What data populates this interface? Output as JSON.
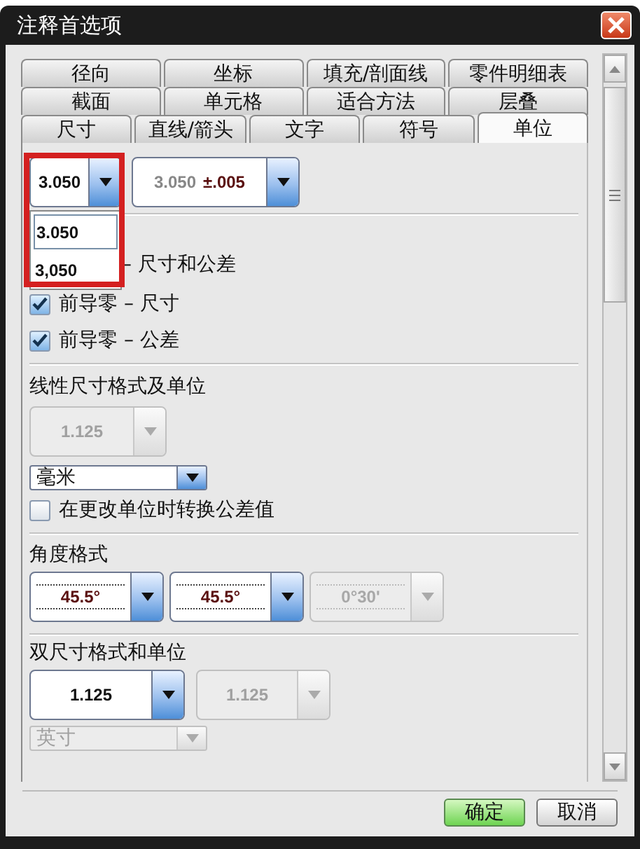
{
  "window": {
    "title": "注释首选项"
  },
  "tabs": [
    [
      {
        "label": "径向",
        "selected": false
      },
      {
        "label": "坐标",
        "selected": false
      },
      {
        "label": "填充/剖面线",
        "selected": false
      },
      {
        "label": "零件明细表",
        "selected": false
      }
    ],
    [
      {
        "label": "截面",
        "selected": false
      },
      {
        "label": "单元格",
        "selected": false
      },
      {
        "label": "适合方法",
        "selected": false
      },
      {
        "label": "层叠",
        "selected": false
      }
    ],
    [
      {
        "label": "尺寸",
        "selected": false
      },
      {
        "label": "直线/箭头",
        "selected": false
      },
      {
        "label": "文字",
        "selected": false
      },
      {
        "label": "符号",
        "selected": false
      },
      {
        "label": "单位",
        "selected": true
      }
    ]
  ],
  "format_combos": [
    {
      "value": "3.050",
      "disabled": false,
      "open": true,
      "highlighted": true
    },
    {
      "value": "3.050",
      "tolerance": "±.005",
      "disabled": false
    }
  ],
  "dropdown_list": [
    {
      "label": "3.050",
      "selected": true
    },
    {
      "label": "3,050",
      "selected": false
    }
  ],
  "leading_zero_options": [
    {
      "kind": "text",
      "label": "– 尺寸和公差"
    },
    {
      "kind": "checkbox",
      "label": "前导零 – 尺寸",
      "checked": true
    },
    {
      "kind": "checkbox",
      "label": "前导零 – 公差",
      "checked": true
    }
  ],
  "linear": {
    "heading": "线性尺寸格式及单位",
    "format_combo": {
      "value": "1.125",
      "disabled": true
    },
    "unit_select": {
      "value": "毫米",
      "disabled": false
    },
    "convert_option": {
      "label": "在更改单位时转换公差值",
      "checked": false
    }
  },
  "angular": {
    "heading": "角度格式",
    "combos": [
      {
        "value": "45.5°",
        "disabled": false
      },
      {
        "value": "45.5°",
        "disabled": false
      },
      {
        "value": "0°30'",
        "disabled": true
      }
    ]
  },
  "dual": {
    "heading": "双尺寸格式和单位",
    "combos": [
      {
        "value": "1.125",
        "disabled": false
      },
      {
        "value": "1.125",
        "disabled": true
      }
    ],
    "unit_select": {
      "value": "英寸",
      "disabled": true
    }
  },
  "buttons": [
    {
      "label": "确定",
      "default": true
    },
    {
      "label": "取消",
      "default": false
    }
  ]
}
